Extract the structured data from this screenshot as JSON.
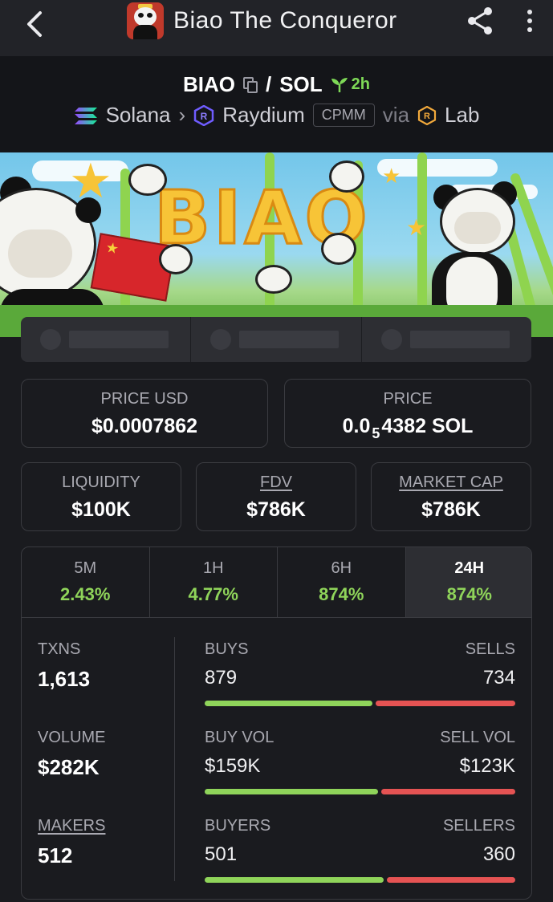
{
  "header": {
    "title": "Biao The Conqueror"
  },
  "pair": {
    "base": "BIAO",
    "separator": "/",
    "quote": "SOL",
    "age": "2h",
    "chain": "Solana",
    "dex": "Raydium",
    "pool_type": "CPMM",
    "via": "via",
    "source": "Lab"
  },
  "banner": {
    "word": "BIAO"
  },
  "prices": {
    "price_usd_label": "PRICE USD",
    "price_usd": "$0.0007862",
    "price_label": "PRICE",
    "price_prefix": "0.0",
    "price_zeros": "5",
    "price_suffix": "4382 SOL"
  },
  "metrics": {
    "liquidity_label": "LIQUIDITY",
    "liquidity": "$100K",
    "fdv_label": "FDV",
    "fdv": "$786K",
    "mcap_label": "MARKET CAP",
    "mcap": "$786K"
  },
  "timeframes": [
    {
      "label": "5M",
      "change": "2.43%"
    },
    {
      "label": "1H",
      "change": "4.77%"
    },
    {
      "label": "6H",
      "change": "874%"
    },
    {
      "label": "24H",
      "change": "874%"
    }
  ],
  "stats": {
    "txns_label": "TXNS",
    "txns": "1,613",
    "buys_label": "BUYS",
    "buys": "879",
    "sells_label": "SELLS",
    "sells": "734",
    "volume_label": "VOLUME",
    "volume": "$282K",
    "buy_vol_label": "BUY VOL",
    "buy_vol": "$159K",
    "sell_vol_label": "SELL VOL",
    "sell_vol": "$123K",
    "makers_label": "MAKERS",
    "makers": "512",
    "buyers_label": "BUYERS",
    "buyers": "501",
    "sellers_label": "SELLERS",
    "sellers": "360"
  },
  "ratios": {
    "txns_buy_fraction": 0.545,
    "volume_buy_fraction": 0.564,
    "makers_buy_fraction": 0.582
  },
  "colors": {
    "positive": "#8fd45a",
    "negative": "#e55353",
    "age_green": "#7ed957"
  }
}
